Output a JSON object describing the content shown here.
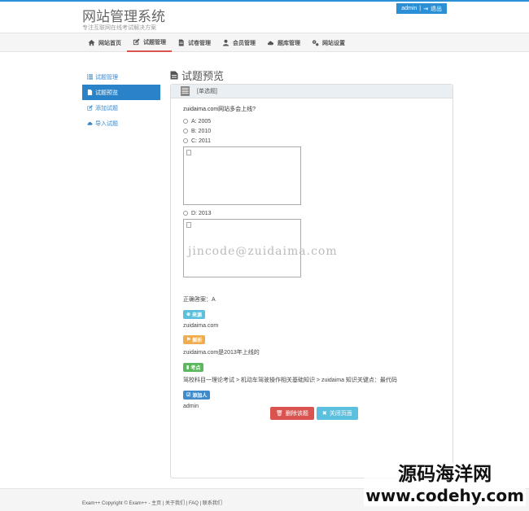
{
  "header": {
    "title": "网站管理系统",
    "subtitle": "专注互联网在线考试解决方案",
    "user": "admin",
    "logout": "退出"
  },
  "nav": {
    "items": [
      {
        "label": "网站首页",
        "icon": "home-icon"
      },
      {
        "label": "试题管理",
        "icon": "edit-icon"
      },
      {
        "label": "试卷管理",
        "icon": "file-icon"
      },
      {
        "label": "会员管理",
        "icon": "user-icon"
      },
      {
        "label": "题库管理",
        "icon": "cloud-icon"
      },
      {
        "label": "网站设置",
        "icon": "gears-icon"
      }
    ]
  },
  "sidebar": {
    "items": [
      {
        "label": "试题管理"
      },
      {
        "label": "试题预览"
      },
      {
        "label": "添加试题"
      },
      {
        "label": "导入试题"
      }
    ]
  },
  "main": {
    "page_title": "试题预览",
    "question_type": "[单选题]",
    "question": "zuidaima.com网站多会上线?",
    "options": [
      "A: 2005",
      "B: 2010",
      "C: 2011",
      "D: 2013"
    ],
    "answer": "正确答案：A",
    "source_label": "来源",
    "source": "zuidaima.com",
    "analysis_label": "解析",
    "analysis": "zuidaima.com是2013年上线的",
    "point_label": "考点",
    "point": "驾校科目一理论考试 > 机动车驾驶操作相关基础知识 > zuidaima 知识关键点：最代码",
    "adder_label": "添加人",
    "adder": "admin",
    "delete_btn": "删除该题",
    "close_btn": "关闭页面"
  },
  "watermark": "jincode@zuidaima.com",
  "footer": {
    "copyright": "Exam++ Copyright © Exam++ - ",
    "links": [
      "主页",
      "关于我们",
      "FAQ",
      "联系我们"
    ]
  },
  "logo": {
    "line1": "源码海洋网",
    "line2": "www.codehy.com"
  },
  "colors": {
    "accent": "#2b8fd6",
    "danger": "#d9534f",
    "info": "#5bc0de",
    "warning": "#f0ad4e",
    "success": "#5cb85c",
    "primary": "#428bca"
  }
}
